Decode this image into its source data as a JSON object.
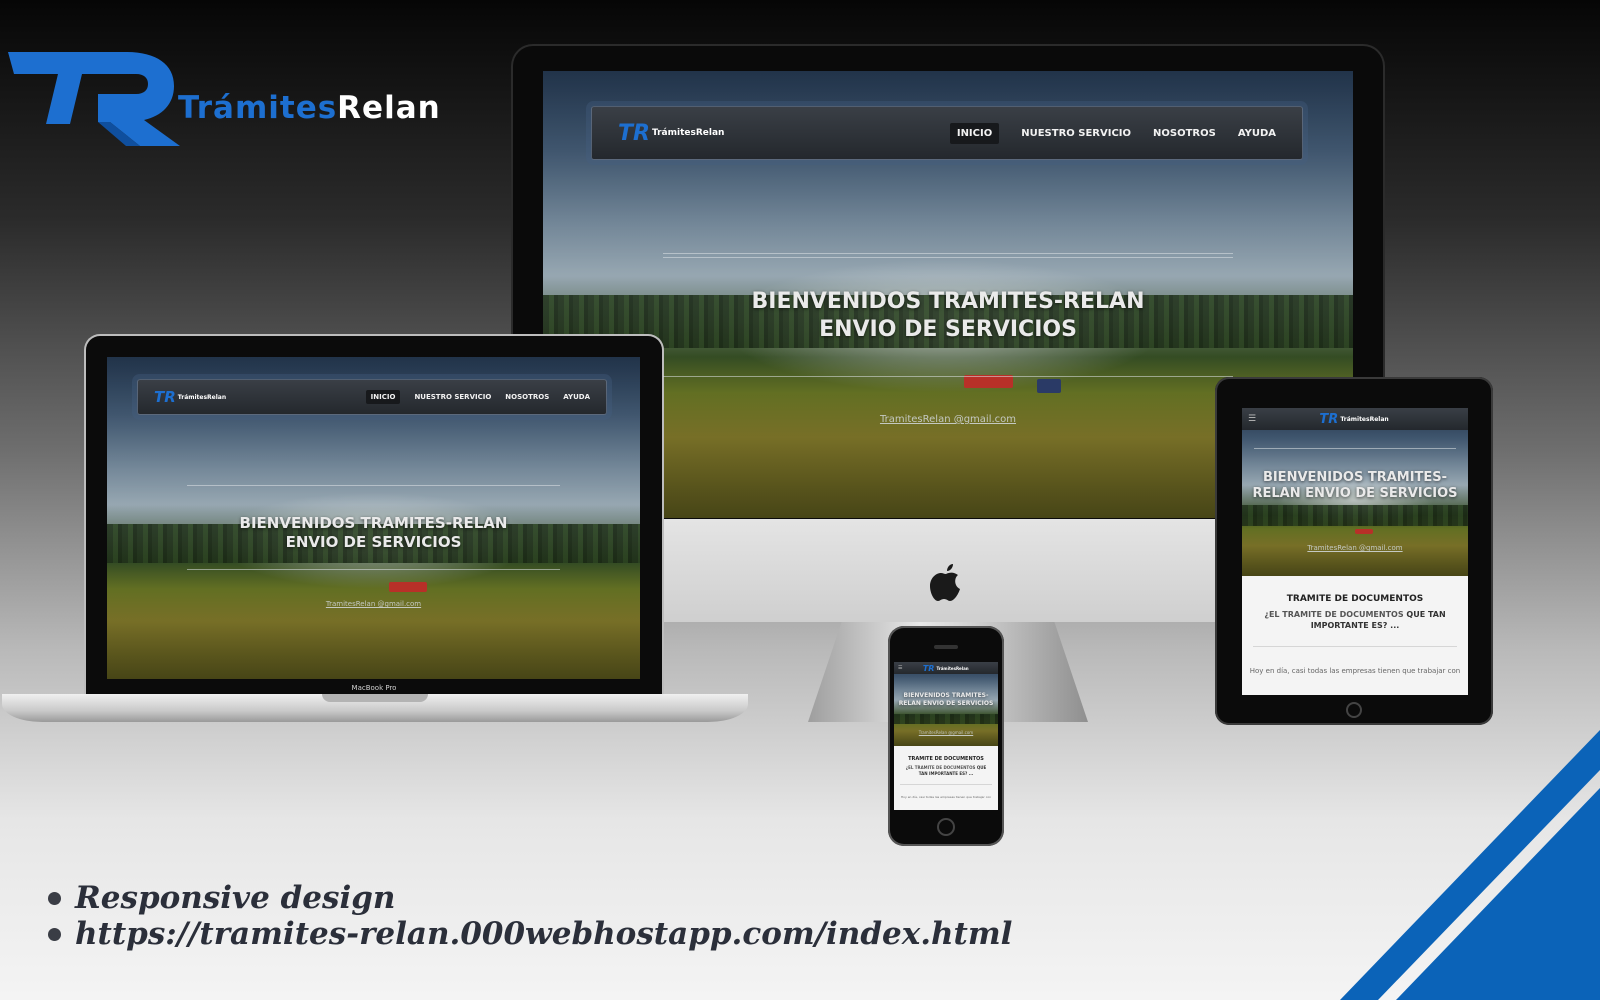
{
  "brand": {
    "word_part1": "Trámites",
    "word_part2": "Relan",
    "logo_color": "#1d6fd0"
  },
  "site": {
    "nav": {
      "logo_tr": "TR",
      "logo_text": "TrámitesRelan",
      "items": [
        "INICIO",
        "NUESTRO SERVICIO",
        "NOSOTROS",
        "AYUDA"
      ]
    },
    "hero": {
      "title_line1": "BIENVENIDOS TRAMITES-RELAN",
      "title_line2": "ENVIO DE SERVICIOS",
      "email": "TramitesRelan @gmail.com"
    },
    "tablet_hero": {
      "title_line1": "BIENVENIDOS TRAMITES-",
      "title_line2": "RELAN ENVIO DE SERVICIOS",
      "email": "TramitesRelan @gmail.com"
    },
    "card": {
      "title": "TRAMITE DE DOCUMENTOS",
      "question_part1": "¿EL TRAMITE DE DOCUMENTOS",
      "question_part2": "QUE TAN IMPORTANTE ES? ...",
      "body": "Hoy en día, casi todas las empresas tienen que trabajar con"
    }
  },
  "devices": {
    "laptop_label": "MacBook Pro"
  },
  "bullets": [
    "Responsive design",
    "https://tramites-relan.000webhostapp.com/index.html"
  ],
  "colors": {
    "accent_blue": "#1d6fd0",
    "stripe_blue": "#0b63b8"
  }
}
